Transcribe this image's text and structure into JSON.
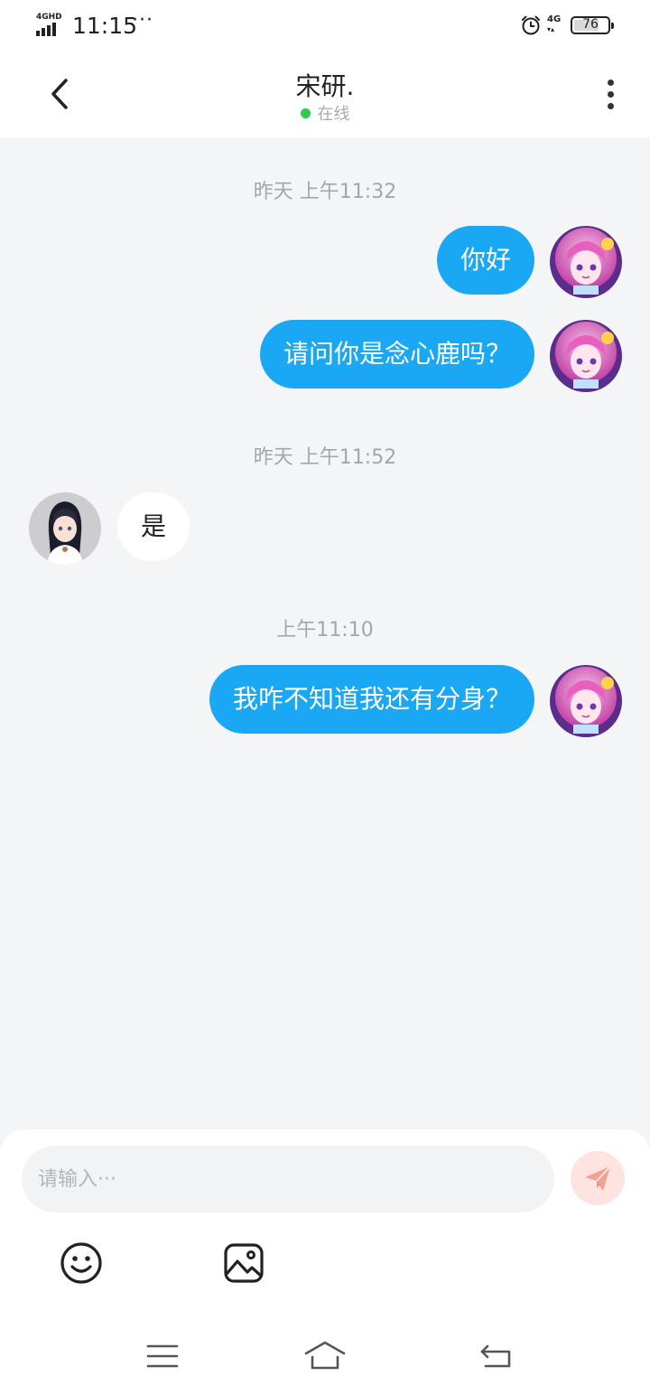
{
  "status_bar": {
    "network": "4GHD",
    "time": "11:15",
    "more_dots": "···",
    "data_type": "4G",
    "battery": "76",
    "battery_level": 0.76
  },
  "header": {
    "title": "宋研.",
    "status": "在线",
    "online_color": "#2ecc4e"
  },
  "messages": [
    {
      "type": "timestamp",
      "text": "昨天 上午11:32"
    },
    {
      "type": "outgoing",
      "text": "你好",
      "avatar": "anime-pink-hair-avatar"
    },
    {
      "type": "outgoing",
      "text": "请问你是念心鹿吗？",
      "avatar": "anime-pink-hair-avatar"
    },
    {
      "type": "timestamp",
      "text": "昨天 上午11:52"
    },
    {
      "type": "incoming",
      "text": "是",
      "avatar": "anime-dark-hair-avatar"
    },
    {
      "type": "timestamp",
      "text": "上午11:10"
    },
    {
      "type": "outgoing",
      "text": "我咋不知道我还有分身？",
      "avatar": "anime-pink-hair-avatar"
    }
  ],
  "input": {
    "placeholder": "请输入···",
    "value": ""
  },
  "colors": {
    "outgoing_bubble": "#1aa8f5",
    "incoming_bubble": "#ffffff",
    "chat_background": "#f4f5f7",
    "send_button": "#fde4e0",
    "send_icon": "#f4a091"
  },
  "icons": {
    "back": "chevron-left-icon",
    "more": "more-vertical-icon",
    "send": "paper-plane-icon",
    "emoji": "smiley-icon",
    "image": "image-icon",
    "nav_menu": "menu-icon",
    "nav_home": "home-icon",
    "nav_back": "return-icon"
  }
}
